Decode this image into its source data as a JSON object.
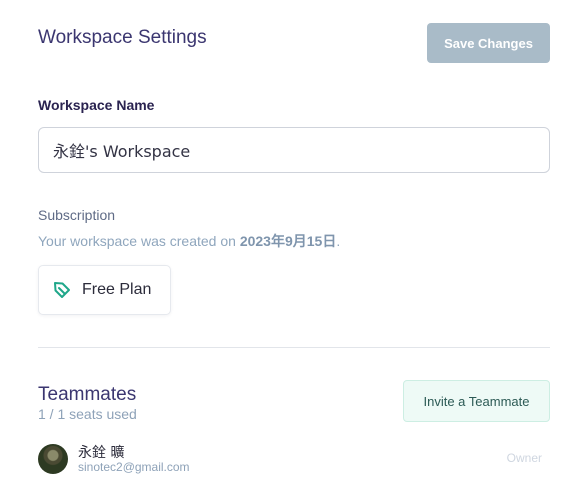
{
  "header": {
    "title": "Workspace Settings",
    "save_label": "Save Changes"
  },
  "workspace": {
    "name_label": "Workspace Name",
    "name_value": "永銓's Workspace"
  },
  "subscription": {
    "heading": "Subscription",
    "created_prefix": "Your workspace was created on ",
    "created_date": "2023年9月15日",
    "created_suffix": ".",
    "plan_label": "Free Plan",
    "plan_icon": "leaf-tag-icon",
    "accent_color": "#1fa78a"
  },
  "teammates": {
    "heading": "Teammates",
    "seats_text": "1 / 1 seats used",
    "invite_label": "Invite a Teammate",
    "members": [
      {
        "name": "永銓 曠",
        "email": "sinotec2@gmail.com",
        "role": "Owner"
      }
    ]
  }
}
